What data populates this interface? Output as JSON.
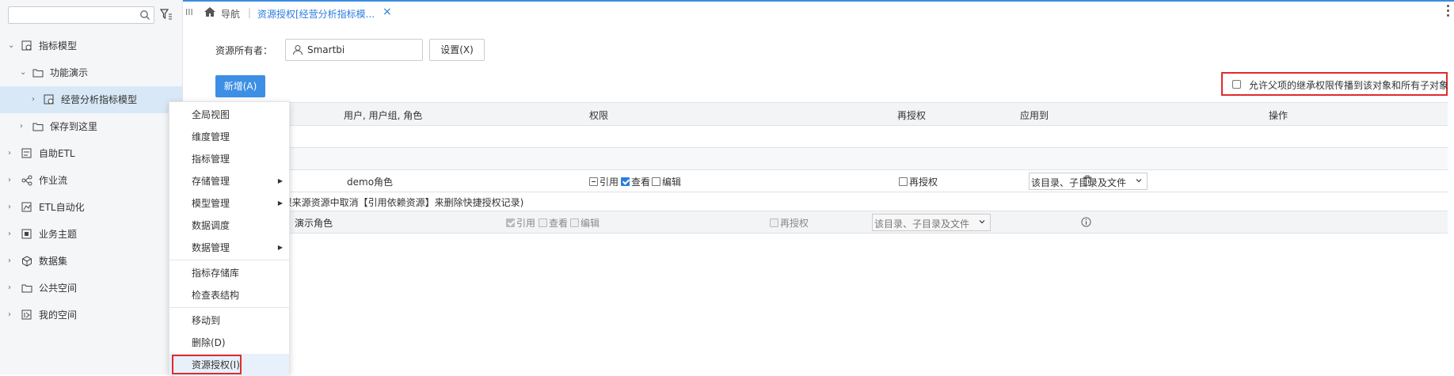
{
  "sidebar": {
    "search_placeholder": "",
    "items": [
      {
        "label": "指标模型",
        "icon": "model-icon"
      },
      {
        "label": "功能演示",
        "icon": "folder-icon"
      },
      {
        "label": "经营分析指标模型",
        "icon": "model-icon"
      },
      {
        "label": "保存到这里",
        "icon": "folder-icon"
      },
      {
        "label": "自助ETL",
        "icon": "etl-icon"
      },
      {
        "label": "作业流",
        "icon": "workflow-icon"
      },
      {
        "label": "ETL自动化",
        "icon": "etl-auto-icon"
      },
      {
        "label": "业务主题",
        "icon": "business-theme-icon"
      },
      {
        "label": "数据集",
        "icon": "dataset-icon"
      },
      {
        "label": "公共空间",
        "icon": "folder-icon"
      },
      {
        "label": "我的空间",
        "icon": "my-space-icon"
      }
    ]
  },
  "topbar": {
    "menu_glyph": "III",
    "nav_label": "导航",
    "separator": "|",
    "tab_label": "资源授权[经营分析指标模...",
    "close_glyph": "×"
  },
  "owner": {
    "label": "资源所有者：",
    "value": "Smartbi",
    "set_button": "设置(X)"
  },
  "add_button": "新增(A)",
  "inherit_label": "允许父项的继承权限传播到该对象和所有子对象",
  "table": {
    "headers": [
      "用户, 用户组, 角色",
      "权限",
      "再授权",
      "应用到",
      "操作"
    ],
    "rows": [
      {
        "name": "demo角色",
        "perms": [
          {
            "label": "引用",
            "state": "partial"
          },
          {
            "label": "查看",
            "state": "checked"
          },
          {
            "label": "编辑",
            "state": "unchecked"
          }
        ],
        "regrant": "再授权",
        "apply_to": "该目录、子目录及文件",
        "action_icon": "delete-icon"
      },
      {
        "note": "(可在权限来源资源中取消【引用依赖资源】来删除快捷授权记录)"
      },
      {
        "name": "演示角色",
        "perms": [
          {
            "label": "引用",
            "state": "checked-disabled"
          },
          {
            "label": "查看",
            "state": "disabled"
          },
          {
            "label": "编辑",
            "state": "disabled"
          }
        ],
        "regrant": "再授权",
        "apply_to": "该目录、子目录及文件",
        "action_icon": "info-icon"
      }
    ]
  },
  "context_menu": {
    "items": [
      {
        "label": "全局视图"
      },
      {
        "label": "维度管理"
      },
      {
        "label": "指标管理"
      },
      {
        "label": "存储管理",
        "submenu": true
      },
      {
        "label": "模型管理",
        "submenu": true
      },
      {
        "label": "数据调度"
      },
      {
        "label": "数据管理",
        "submenu": true
      },
      {
        "label": "指标存储库"
      },
      {
        "label": "检查表结构"
      },
      {
        "label": "移动到"
      },
      {
        "label": "删除(D)"
      },
      {
        "label": "资源授权(I)"
      }
    ],
    "submenu_glyph": "▶"
  },
  "colors": {
    "accent": "#3d8fe6",
    "highlight_border": "#e02b2b",
    "selected_row": "#d8e8f7"
  }
}
